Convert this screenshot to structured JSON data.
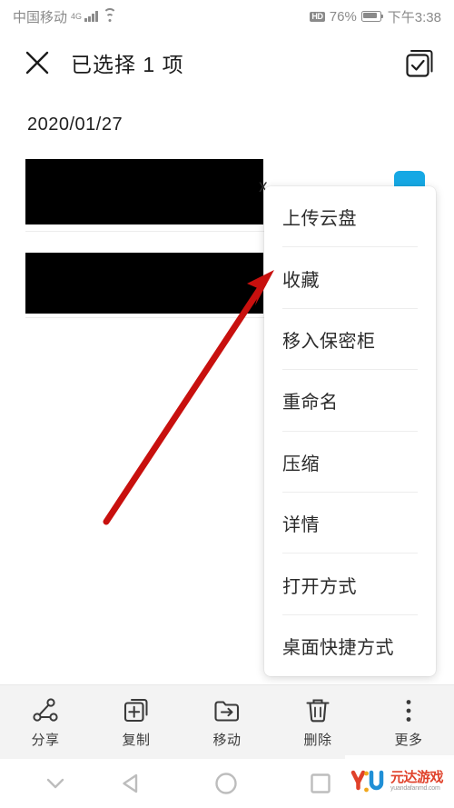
{
  "status_bar": {
    "carrier": "中国移动",
    "network_type": "4G",
    "signal_icon": "signal-bars-icon",
    "wifi_icon": "wifi-icon",
    "hd_badge": "HD",
    "battery_percent": "76%",
    "battery_icon": "battery-icon",
    "clock": "下午3:38"
  },
  "header": {
    "close_icon": "close-icon",
    "title": "已选择 1 项",
    "select_all_icon": "select-all-checkbox-icon"
  },
  "file_list": {
    "date_group_label": "2020/01/27",
    "file_name_fragment": "x",
    "rows": [
      {
        "redacted": true
      },
      {
        "redacted": true
      }
    ]
  },
  "context_menu": {
    "items": [
      {
        "label": "上传云盘"
      },
      {
        "label": "收藏"
      },
      {
        "label": "移入保密柜"
      },
      {
        "label": "重命名"
      },
      {
        "label": "压缩"
      },
      {
        "label": "详情"
      },
      {
        "label": "打开方式"
      },
      {
        "label": "桌面快捷方式"
      }
    ]
  },
  "bottom_toolbar": {
    "buttons": [
      {
        "label": "分享",
        "icon": "share-icon"
      },
      {
        "label": "复制",
        "icon": "copy-icon"
      },
      {
        "label": "移动",
        "icon": "move-to-folder-icon"
      },
      {
        "label": "删除",
        "icon": "trash-icon"
      },
      {
        "label": "更多",
        "icon": "more-vertical-icon"
      }
    ]
  },
  "nav_bar": {
    "hide_icon": "chevron-down-icon",
    "back_icon": "back-triangle-icon",
    "home_icon": "home-circle-icon",
    "recents_icon": "recents-square-icon"
  },
  "watermark": {
    "title": "元达游戏",
    "url": "yuandafanmd.com",
    "logo_icon": "yu-logo-icon"
  },
  "colors": {
    "selection_blue": "#16A8E4",
    "annotation_red": "#C8100E",
    "toolbar_bg": "#F3F3F3",
    "status_gray": "#8A8A8A",
    "text_primary": "#2B2B2B",
    "redaction_black": "#000000"
  }
}
